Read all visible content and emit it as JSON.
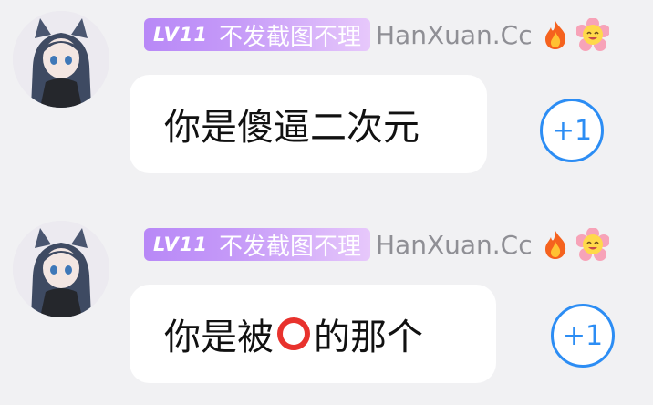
{
  "messages": [
    {
      "level": "LV11",
      "title": "不发截图不理",
      "username": "HanXuan.Cc",
      "text_before": "你是傻逼二次元",
      "text_after": "",
      "plus_one": "+1"
    },
    {
      "level": "LV11",
      "title": "不发截图不理",
      "username": "HanXuan.Cc",
      "text_before": "你是被",
      "emoji": "red-circle-icon",
      "text_after": "的那个",
      "plus_one": "+1"
    }
  ],
  "colors": {
    "badge_start": "#b888f7",
    "badge_end": "#e7c8fb",
    "plus_one_blue": "#2c8df4",
    "username_gray": "#8f8f95",
    "background": "#f1f1f3"
  }
}
